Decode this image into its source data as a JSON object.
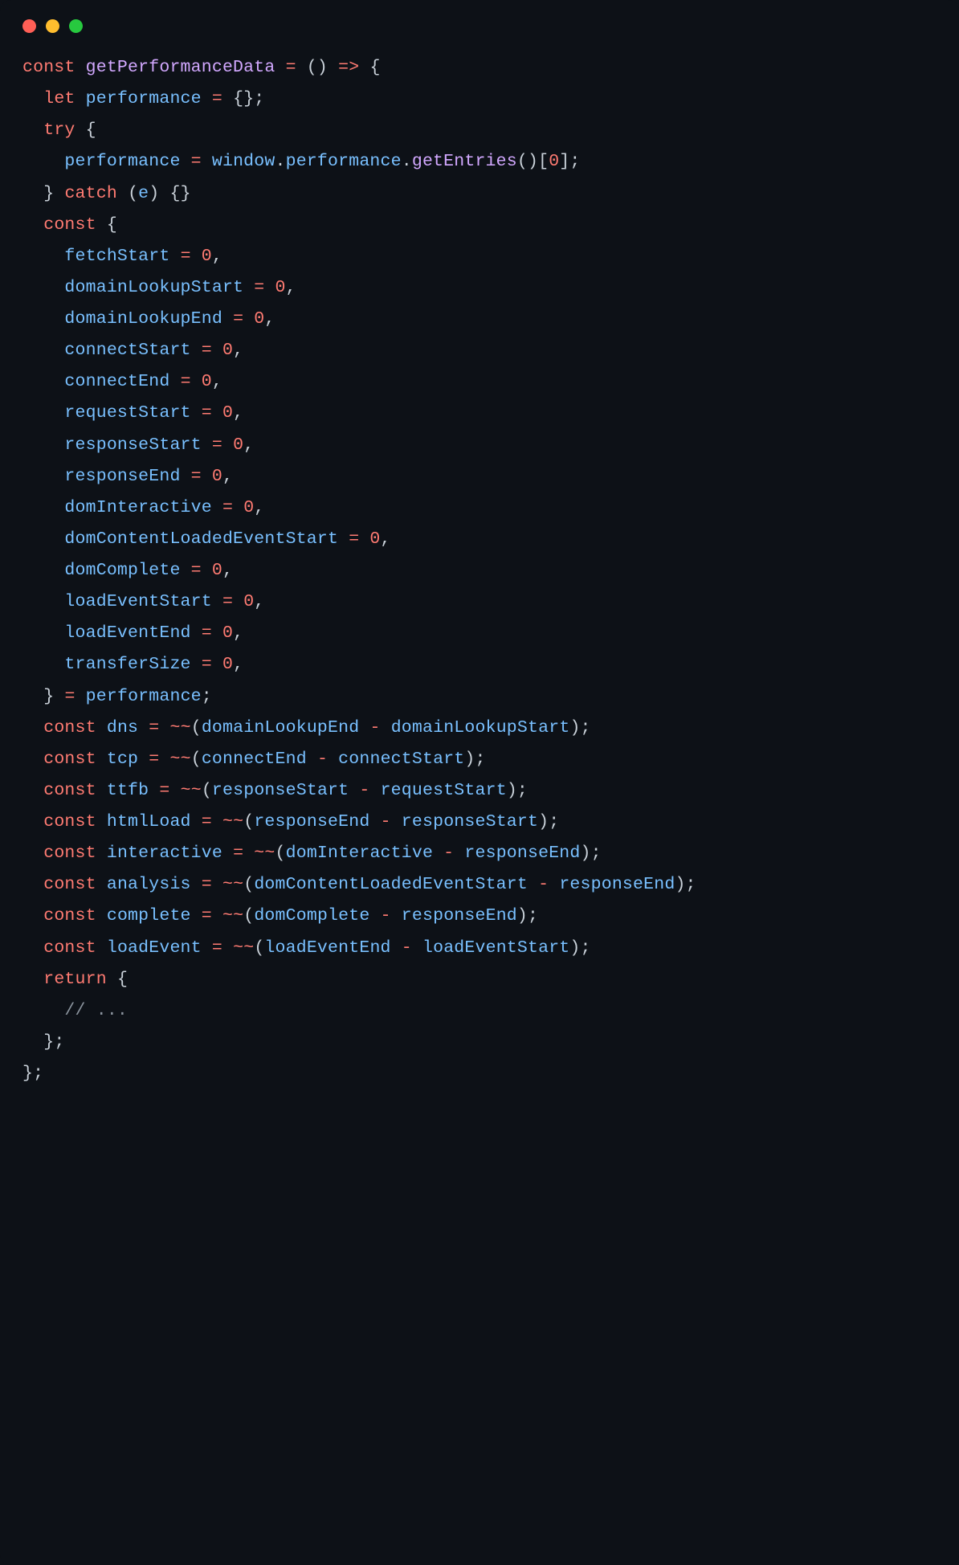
{
  "traffic": {
    "red": "#ff5f56",
    "yellow": "#ffbd2e",
    "green": "#27c93f"
  },
  "code": {
    "kw_const": "const",
    "kw_let": "let",
    "kw_try": "try",
    "kw_catch": "catch",
    "kw_return": "return",
    "fn_name": "getPerformanceData",
    "arrow": "=>",
    "var_performance": "performance",
    "obj_window": "window",
    "fn_getEntries": "getEntries",
    "idx_zero": "0",
    "param_e": "e",
    "fields": {
      "fetchStart": "fetchStart",
      "domainLookupStart": "domainLookupStart",
      "domainLookupEnd": "domainLookupEnd",
      "connectStart": "connectStart",
      "connectEnd": "connectEnd",
      "requestStart": "requestStart",
      "responseStart": "responseStart",
      "responseEnd": "responseEnd",
      "domInteractive": "domInteractive",
      "domContentLoadedEventStart": "domContentLoadedEventStart",
      "domComplete": "domComplete",
      "loadEventStart": "loadEventStart",
      "loadEventEnd": "loadEventEnd",
      "transferSize": "transferSize"
    },
    "default_zero": "0",
    "vars": {
      "dns": "dns",
      "tcp": "tcp",
      "ttfb": "ttfb",
      "htmlLoad": "htmlLoad",
      "interactive": "interactive",
      "analysis": "analysis",
      "complete": "complete",
      "loadEvent": "loadEvent"
    },
    "tilde": "~~",
    "comment_ellipsis": "// ..."
  }
}
